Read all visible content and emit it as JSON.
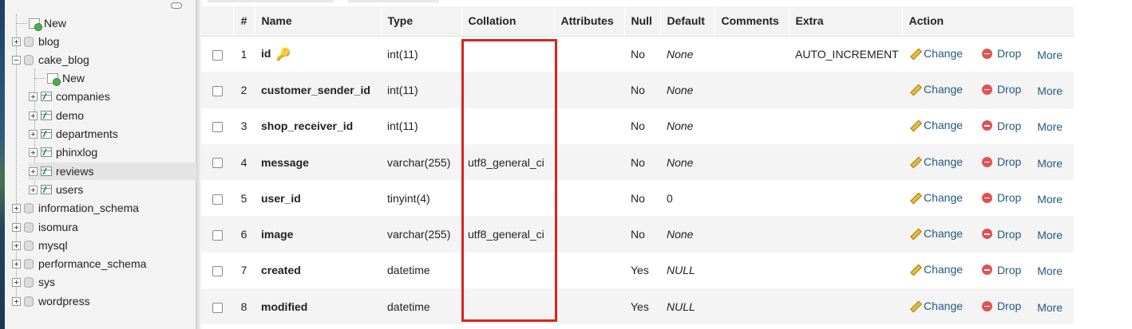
{
  "nav": {
    "items": [
      {
        "label": "New",
        "kind": "new"
      },
      {
        "label": "blog",
        "kind": "db"
      },
      {
        "label": "cake_blog",
        "kind": "db-open"
      },
      {
        "label": "New",
        "kind": "new-child"
      },
      {
        "label": "companies",
        "kind": "table"
      },
      {
        "label": "demo",
        "kind": "table"
      },
      {
        "label": "departments",
        "kind": "table"
      },
      {
        "label": "phinxlog",
        "kind": "table"
      },
      {
        "label": "reviews",
        "kind": "table-active"
      },
      {
        "label": "users",
        "kind": "table"
      },
      {
        "label": "information_schema",
        "kind": "db"
      },
      {
        "label": "isomura",
        "kind": "db"
      },
      {
        "label": "mysql",
        "kind": "db"
      },
      {
        "label": "performance_schema",
        "kind": "db"
      },
      {
        "label": "sys",
        "kind": "db"
      },
      {
        "label": "wordpress",
        "kind": "db"
      }
    ]
  },
  "table": {
    "headers": {
      "num": "#",
      "name": "Name",
      "type": "Type",
      "collation": "Collation",
      "attributes": "Attributes",
      "null": "Null",
      "default": "Default",
      "comments": "Comments",
      "extra": "Extra",
      "action": "Action"
    },
    "rows": [
      {
        "num": "1",
        "name": "id",
        "type": "int(11)",
        "collation": "",
        "attributes": "",
        "null": "No",
        "default": "None",
        "comments": "",
        "extra": "AUTO_INCREMENT",
        "change": "Change",
        "drop": "Drop",
        "more": "More"
      },
      {
        "num": "2",
        "name": "customer_sender_id",
        "type": "int(11)",
        "collation": "",
        "attributes": "",
        "null": "No",
        "default": "None",
        "comments": "",
        "extra": "",
        "change": "Change",
        "drop": "Drop",
        "more": "More"
      },
      {
        "num": "3",
        "name": "shop_receiver_id",
        "type": "int(11)",
        "collation": "",
        "attributes": "",
        "null": "No",
        "default": "None",
        "comments": "",
        "extra": "",
        "change": "Change",
        "drop": "Drop",
        "more": "More"
      },
      {
        "num": "4",
        "name": "message",
        "type": "varchar(255)",
        "collation": "utf8_general_ci",
        "attributes": "",
        "null": "No",
        "default": "None",
        "comments": "",
        "extra": "",
        "change": "Change",
        "drop": "Drop",
        "more": "More"
      },
      {
        "num": "5",
        "name": "user_id",
        "type": "tinyint(4)",
        "collation": "",
        "attributes": "",
        "null": "No",
        "default": "0",
        "comments": "",
        "extra": "",
        "change": "Change",
        "drop": "Drop",
        "more": "More"
      },
      {
        "num": "6",
        "name": "image",
        "type": "varchar(255)",
        "collation": "utf8_general_ci",
        "attributes": "",
        "null": "No",
        "default": "None",
        "comments": "",
        "extra": "",
        "change": "Change",
        "drop": "Drop",
        "more": "More"
      },
      {
        "num": "7",
        "name": "created",
        "type": "datetime",
        "collation": "",
        "attributes": "",
        "null": "Yes",
        "default": "NULL",
        "comments": "",
        "extra": "",
        "change": "Change",
        "drop": "Drop",
        "more": "More"
      },
      {
        "num": "8",
        "name": "modified",
        "type": "datetime",
        "collation": "",
        "attributes": "",
        "null": "Yes",
        "default": "NULL",
        "comments": "",
        "extra": "",
        "change": "Change",
        "drop": "Drop",
        "more": "More"
      }
    ]
  },
  "colors": {
    "highlight": "#d9241c",
    "link": "#235a81",
    "header_bg": "#f3f3f3",
    "row_alt_bg": "#f4f4f4"
  },
  "icons": {
    "primary_key": "key-icon",
    "change": "pencil-icon",
    "drop": "drop-circle-icon"
  }
}
